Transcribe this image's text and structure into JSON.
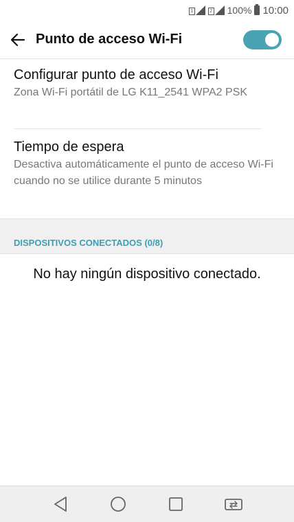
{
  "status_bar": {
    "battery_text": "100%",
    "time": "10:00",
    "sim1_label": "1",
    "sim2_label": "2"
  },
  "header": {
    "back_icon": "arrow-left-icon",
    "title": "Punto de acceso Wi-Fi",
    "toggle_on": true
  },
  "settings": [
    {
      "title": "Configurar punto de acceso Wi-Fi",
      "subtitle": "Zona Wi-Fi portátil de LG K11_2541 WPA2 PSK"
    },
    {
      "title": "Tiempo de espera",
      "subtitle": "Desactiva automáticamente el punto de acceso Wi-Fi cuando no se utilice durante 5 minutos"
    }
  ],
  "connected": {
    "header": "DISPOSITIVOS CONECTADOS (0/8)",
    "empty_message": "No hay ningún dispositivo conectado."
  },
  "nav": {
    "back_icon": "triangle-back-icon",
    "home_icon": "circle-home-icon",
    "recents_icon": "square-recents-icon",
    "switch_icon": "dual-window-icon"
  },
  "colors": {
    "accent": "#4aa3b3",
    "section_header_text": "#3a9fb5"
  }
}
